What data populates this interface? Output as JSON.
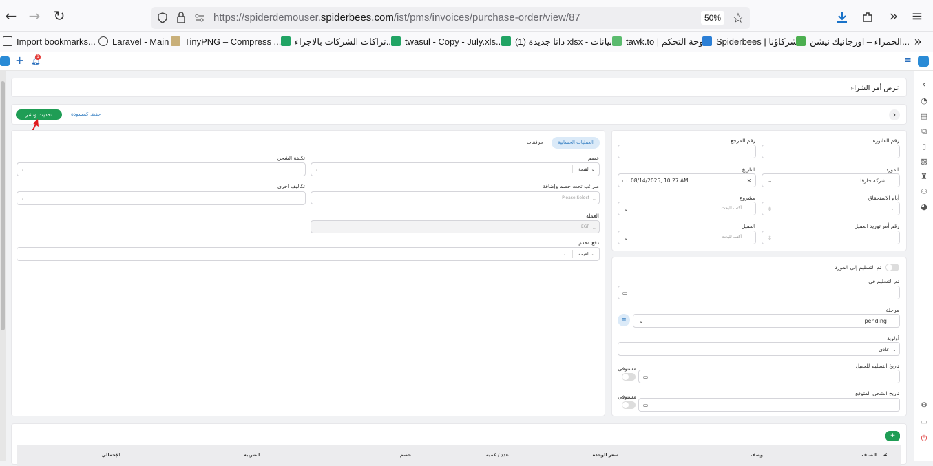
{
  "browser": {
    "url_prefix": "https://spiderdemouser.",
    "url_domain": "spiderbees.com",
    "url_path": "/ist/pms/invoices/purchase-order/view/87",
    "zoom": "50%",
    "bookmarks": [
      {
        "label": "Import bookmarks..."
      },
      {
        "label": "Laravel - Main"
      },
      {
        "label": "TinyPNG – Compress ..."
      },
      {
        "label": "تراكات الشركات بالاجزاء..."
      },
      {
        "label": "twasul - Copy - July.xls..."
      },
      {
        "label": "داتا جديدة (1) xlsx - بيانات..."
      },
      {
        "label": "tawk.to | لوحة التحكم"
      },
      {
        "label": "Spiderbees | شركاؤنا"
      },
      {
        "label": "الحمراء – اورجانيك نيشن..."
      }
    ]
  },
  "app": {
    "notification_count": "1",
    "page_title": "عرض أمر الشراء",
    "save_draft": "حفظ كمسودة",
    "update_publish": "تحديث ونشر"
  },
  "tabs": {
    "active": "العمليات الحسابية",
    "other": "مرفقات"
  },
  "form_left": {
    "discount_label": "خصم",
    "discount_type": "القيمة",
    "discount_value": "٠",
    "shipping_label": "تكلفة الشحن",
    "shipping_value": "٠",
    "tax_label": "ضرائب تحت خصم وإضافة",
    "tax_placeholder": "Please Select",
    "other_costs_label": "تكاليف اخرى",
    "other_costs_value": "٠",
    "currency_label": "العملة",
    "currency_value": "EGP",
    "advance_label": "دفع مقدم",
    "advance_type": "القيمة",
    "advance_value": "٠"
  },
  "form_right": {
    "invoice_no_label": "رقم الفاتورة",
    "reference_label": "رقم المرجع",
    "supplier_label": "المورد",
    "supplier_value": "شركة خارقا",
    "date_label": "التاريخ",
    "date_value": "08/14/2025, 10:27 AM",
    "due_days_label": "أيام الاستحقاق",
    "due_days_value": "٠",
    "project_label": "مشروع",
    "project_placeholder": "أكتب للبحث",
    "customer_po_label": "رقم أمر توريد العميل",
    "customer_label": "العميل",
    "customer_placeholder": "أكتب للبحث"
  },
  "delivery": {
    "delivered_toggle_label": "تم التسليم إلى المورد",
    "delivered_in_label": "تم التسليم في",
    "stage_label": "مرحلة",
    "stage_value": "pending",
    "priority_label": "أولوية",
    "priority_value": "عادى",
    "customer_delivery_label": "تاريخ التسليم للعميل",
    "expected_shipping_label": "تاريخ الشحن المتوقع",
    "received_label_1": "مستوفى",
    "received_label_2": "مستوفى"
  },
  "table": {
    "headers": [
      "#",
      "الصنف",
      "وصف",
      "سعر الوحدة",
      "عدد / كمية",
      "خصم",
      "الضريبة",
      "الإجمالي"
    ]
  },
  "colors": {
    "accent_green": "#1f9d55",
    "link_blue": "#3a82c4",
    "annotation_red": "#e0191d"
  }
}
